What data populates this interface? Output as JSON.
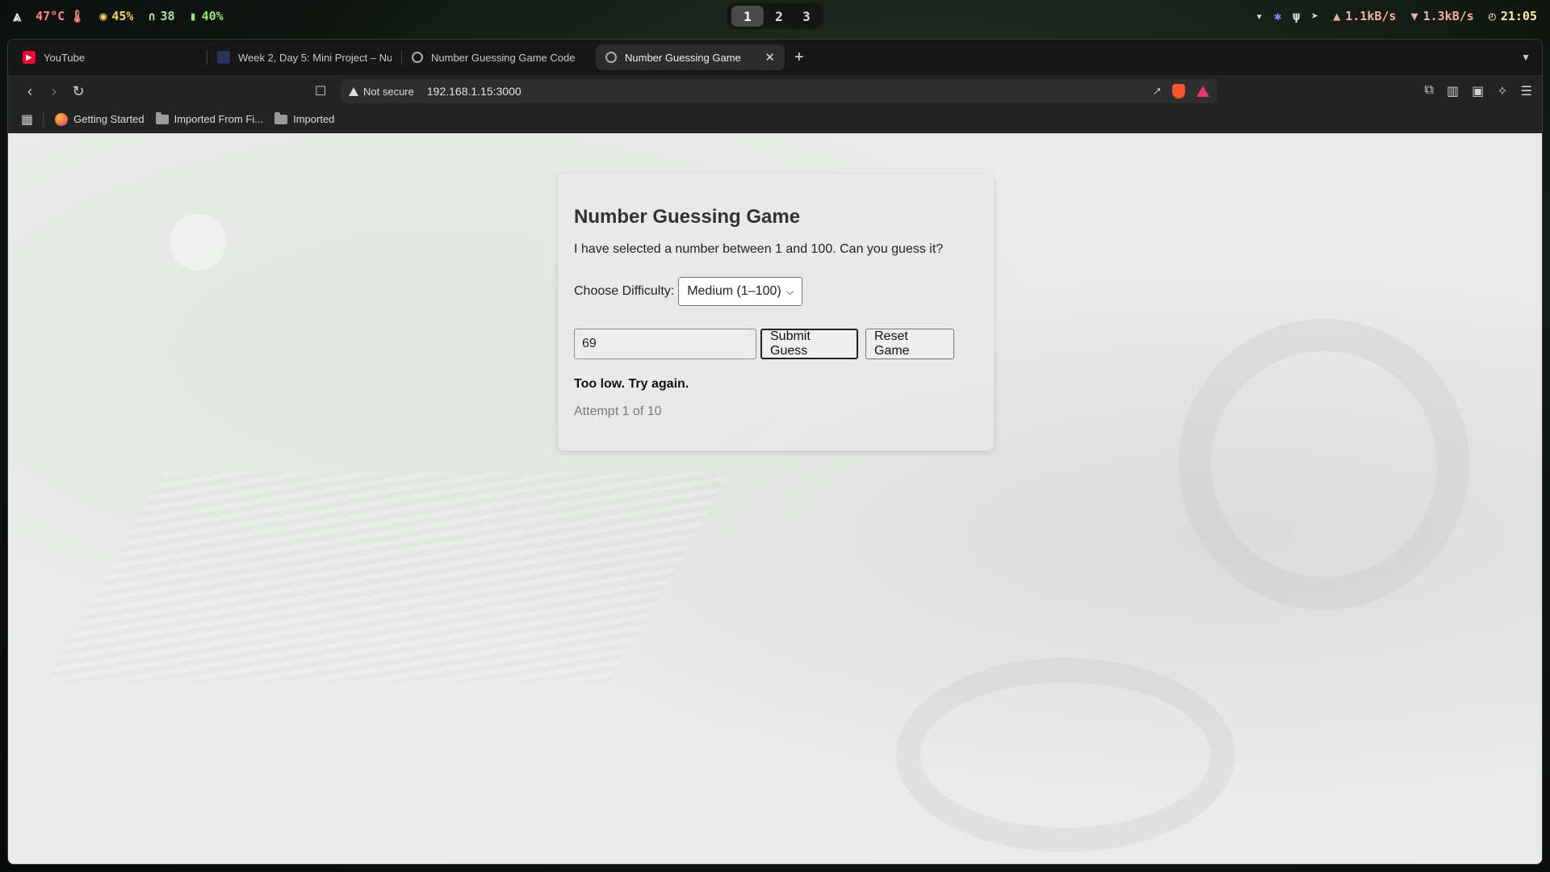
{
  "system_bar": {
    "temperature": "47°C",
    "cpu": "45%",
    "headphones": "38",
    "battery": "40%",
    "workspaces": [
      "1",
      "2",
      "3"
    ],
    "active_workspace": "1",
    "upload": "1.1kB/s",
    "download": "1.3kB/s",
    "clock": "21:05"
  },
  "browser": {
    "tabs": [
      {
        "label": "YouTube",
        "icon": "youtube-icon",
        "active": false
      },
      {
        "label": "Week 2, Day 5: Mini Project – Nu",
        "icon": "blog-icon",
        "active": false
      },
      {
        "label": "Number Guessing Game Code",
        "icon": "globe-icon",
        "active": false
      },
      {
        "label": "Number Guessing Game",
        "icon": "globe-icon",
        "active": true
      }
    ],
    "security_label": "Not secure",
    "url": "192.168.1.15:3000",
    "bookmarks": [
      {
        "label": "Getting Started",
        "icon": "firefox-icon"
      },
      {
        "label": "Imported From Fi...",
        "icon": "folder-icon"
      },
      {
        "label": "Imported",
        "icon": "folder-icon"
      }
    ]
  },
  "game": {
    "title": "Number Guessing Game",
    "prompt": "I have selected a number between 1 and 100. Can you guess it?",
    "difficulty_label": "Choose Difficulty:",
    "difficulty_value": "Medium (1–100)",
    "guess_value": "69",
    "submit_label": "Submit Guess",
    "reset_label": "Reset Game",
    "feedback": "Too low. Try again.",
    "attempts": "Attempt 1 of 10"
  }
}
